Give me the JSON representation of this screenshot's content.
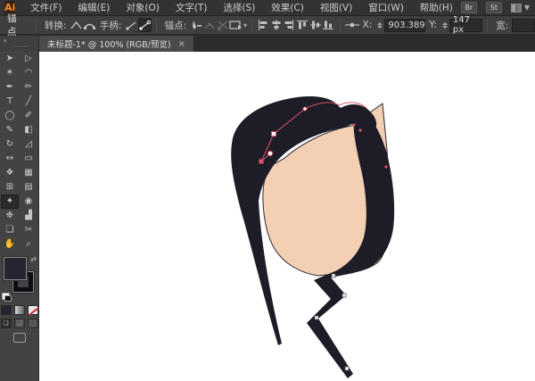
{
  "app": {
    "logo_text": "Ai"
  },
  "menubar": {
    "items": [
      "文件(F)",
      "编辑(E)",
      "对象(O)",
      "文字(T)",
      "选择(S)",
      "效果(C)",
      "视图(V)",
      "窗口(W)",
      "帮助(H)"
    ],
    "bridge_badge": "Br",
    "stock_badge": "St",
    "workspace_caret": "▼"
  },
  "control_bar": {
    "title": "锚点",
    "convert_label": "转换:",
    "handles_label": "手柄:",
    "anchors_label": "锚点:",
    "artboard_caret": "▾",
    "x_label": "X:",
    "x_value": "903.389",
    "y_label": "Y:",
    "y_value": "147 px",
    "width_label": "宽:"
  },
  "document_tab": {
    "title": "未标题-1* @ 100% (RGB/预览)",
    "close": "×",
    "panel_collapse": "»"
  },
  "tools": [
    {
      "name": "selection-tool",
      "glyph": "➤"
    },
    {
      "name": "direct-selection-tool",
      "glyph": "▷"
    },
    {
      "name": "magic-wand-tool",
      "glyph": "✶"
    },
    {
      "name": "lasso-tool",
      "glyph": "◠"
    },
    {
      "name": "pen-tool",
      "glyph": "✒"
    },
    {
      "name": "anchor-point-tool",
      "glyph": "✏"
    },
    {
      "name": "type-tool",
      "glyph": "T"
    },
    {
      "name": "line-segment-tool",
      "glyph": "╱"
    },
    {
      "name": "ellipse-tool",
      "glyph": "◯"
    },
    {
      "name": "paintbrush-tool",
      "glyph": "✐"
    },
    {
      "name": "pencil-tool",
      "glyph": "✎"
    },
    {
      "name": "eraser-tool",
      "glyph": "◧"
    },
    {
      "name": "rotate-tool",
      "glyph": "↻"
    },
    {
      "name": "scale-tool",
      "glyph": "◿"
    },
    {
      "name": "width-tool",
      "glyph": "↔"
    },
    {
      "name": "free-transform-tool",
      "glyph": "▭"
    },
    {
      "name": "shape-builder-tool",
      "glyph": "❖"
    },
    {
      "name": "perspective-grid-tool",
      "glyph": "▦"
    },
    {
      "name": "mesh-tool",
      "glyph": "⊞"
    },
    {
      "name": "gradient-tool",
      "glyph": "▤"
    },
    {
      "name": "eyedropper-tool",
      "glyph": "✦"
    },
    {
      "name": "blend-tool",
      "glyph": "◉"
    },
    {
      "name": "symbol-sprayer-tool",
      "glyph": "❉"
    },
    {
      "name": "column-graph-tool",
      "glyph": "▟"
    },
    {
      "name": "artboard-tool",
      "glyph": "❏"
    },
    {
      "name": "slice-tool",
      "glyph": "✂"
    },
    {
      "name": "hand-tool",
      "glyph": "✋"
    },
    {
      "name": "zoom-tool",
      "glyph": "⌕"
    }
  ],
  "swatches": {
    "fill_color": "#262430",
    "stroke_color": "#0c0c12",
    "swap_glyph": "⇄"
  },
  "canvas": {
    "background": "#ffffff",
    "hair_color": "#1e1c26",
    "face_color": "#f3cfb3",
    "face_outline": "#2a2833",
    "selection_color": "#dd5468"
  }
}
